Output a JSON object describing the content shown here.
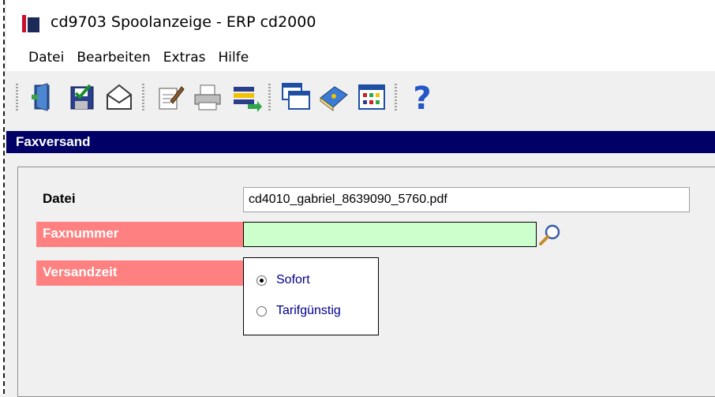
{
  "window": {
    "title": "cd9703 Spoolanzeige  - ERP cd2000"
  },
  "menu": [
    "Datei",
    "Bearbeiten",
    "Extras",
    "Hilfe"
  ],
  "toolbar": {
    "icons": [
      "exit-door-icon",
      "save-icon",
      "envelope-icon",
      "edit-document-icon",
      "printer-icon",
      "stack-transfer-icon",
      "windows-icon",
      "book-icon",
      "grid-icon",
      "help-icon"
    ]
  },
  "panel": {
    "title": "Faxversand"
  },
  "form": {
    "file_label": "Datei",
    "file_value": "cd4010_gabriel_8639090_5760.pdf",
    "fax_label": "Faxnummer",
    "fax_value": "",
    "send_label": "Versandzeit",
    "options": [
      "Sofort",
      "Tarifgünstig"
    ],
    "selected_option": "Sofort"
  },
  "colors": {
    "panel_header": "#000066",
    "required_label": "#ff8080",
    "fax_field": "#ccffcc",
    "radio_text": "#00008b"
  }
}
